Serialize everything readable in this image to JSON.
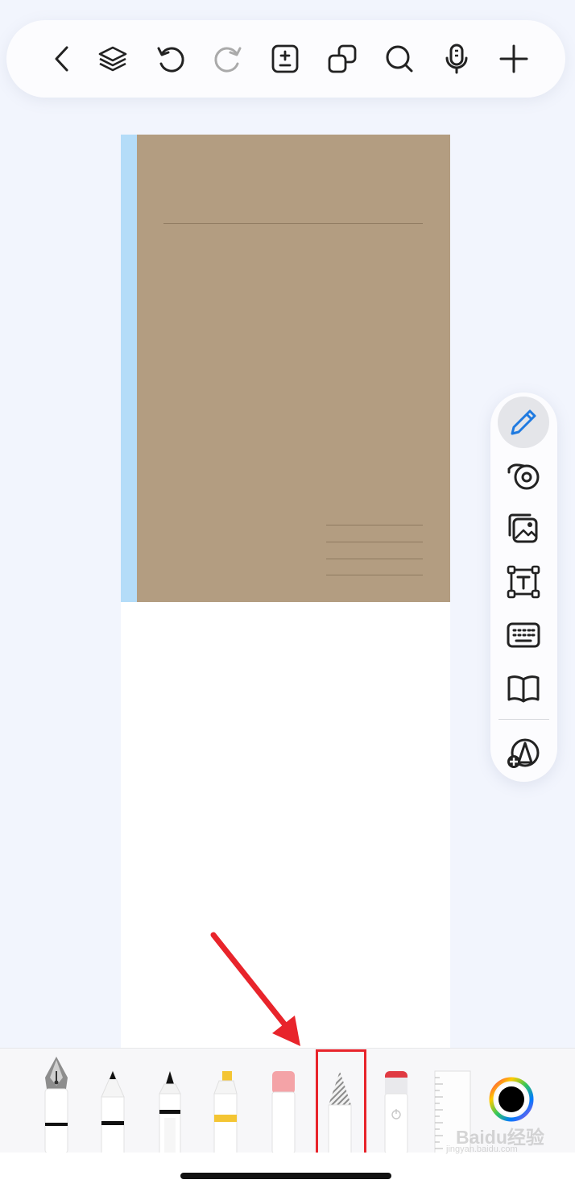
{
  "top_toolbar": {
    "icons": [
      "back-chevron-icon",
      "layers-icon",
      "undo-icon",
      "redo-icon",
      "page-add-remove-icon",
      "duplicate-pages-icon",
      "search-icon",
      "microphone-icon",
      "add-icon"
    ]
  },
  "notebook": {
    "cover_color": "#b39d81",
    "spine_color": "#b4dcf8"
  },
  "side_panel": {
    "tools": [
      "pen-icon",
      "tape-icon",
      "image-icon",
      "text-box-icon",
      "keyboard-icon",
      "book-icon",
      "shape-add-icon"
    ],
    "active_tool": "pen-icon"
  },
  "drawing_toolbar": {
    "tools": [
      "fountain-pen",
      "ballpoint-pen",
      "brush-pen",
      "highlighter",
      "eraser",
      "pencil",
      "lasso-tool",
      "ruler"
    ],
    "selected_tool": "pencil",
    "current_color": "#000000"
  },
  "annotation": {
    "arrow_color": "#e8242b"
  },
  "watermark": {
    "brand": "Baidu经验",
    "url": "jingyan.baidu.com"
  }
}
